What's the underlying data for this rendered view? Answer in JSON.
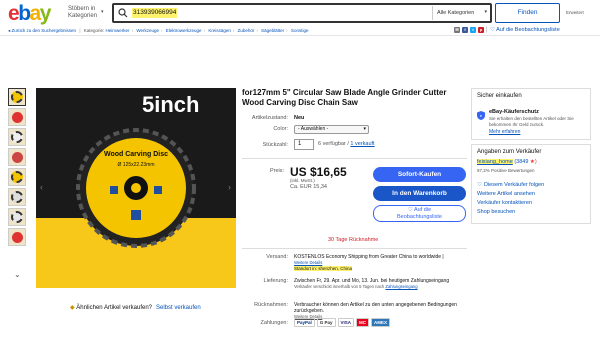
{
  "header": {
    "logo": [
      "e",
      "b",
      "a",
      "y"
    ],
    "category_line1": "Stöbern in",
    "category_line2": "Kategorien",
    "search_value": "313939066994",
    "all_categories": "Alle Kategorien",
    "find_button": "Finden",
    "advanced": "Erweitert"
  },
  "breadcrumb": {
    "back": "Zurück zu den Suchergebnissen",
    "category_label": "Kategorie:",
    "items": [
      "Heimwerker",
      "Werkzeuge",
      "Elektrowerkzeuge",
      "Kreissägen",
      "Zubehör",
      "Sägeblätter",
      "Sonstige"
    ]
  },
  "share": {
    "icons": [
      "mail-icon",
      "facebook-icon",
      "twitter-icon",
      "pinterest-icon"
    ],
    "watch": "Auf die Beobachtungsliste"
  },
  "gallery": {
    "headline": "5inch",
    "blade_text": "Wood Carving Disc",
    "blade_size": "Ø 125x22.23mm",
    "zoom_hint": "",
    "similar_q": "Ähnlichen Artikel verkaufen?",
    "similar_link": "Selbst verkaufen"
  },
  "product": {
    "title": "for127mm 5\" Circular Saw Blade Angle Grinder Cutter Wood Carving Disc Chain Saw",
    "condition_label": "Artikelzustand:",
    "condition_value": "Neu",
    "color_label": "Color:",
    "color_value": "- Auswählen -",
    "qty_label": "Stückzahl:",
    "qty_value": "1",
    "avail": "6 verfügbar / ",
    "sold": "1 verkauft",
    "price_label": "Preis:",
    "price": "US $16,65",
    "price_incl": "(inkl. MwSt.)",
    "price_eur": "Ca. EUR 15,34",
    "buy_now": "Sofort-Kaufen",
    "add_cart": "In den Warenkorb",
    "watch_line1": "♡ Auf die",
    "watch_line2": "Beobachtungsliste",
    "returns": "30 Tage Rücknahme",
    "ship_label": "Versand:",
    "ship_value": "KOSTENLOS   Economy Shipping from Greater China to worldwide |",
    "ship_details": "Weitere Details",
    "location": "Standort in: shenzhen, China",
    "delivery_label": "Lieferung:",
    "delivery_value": "Zwischen Fr, 29. Apr. und Mo, 13. Jun. bei heutigem Zahlungseingang",
    "delivery_note": "Verkäufer verschickt innerhalb von 5 Tagen nach",
    "delivery_note_link": "Zahlungseingang",
    "returns_label": "Rücknahmen:",
    "returns_value": "Verbraucher können den Artikel zu den unten angegebenen Bedingungen zurückgeben.",
    "returns_link": "Weitere Details",
    "payments_label": "Zahlungen:",
    "payments": [
      "PayPal",
      "G Pay",
      "VISA",
      "MC",
      "AMEX"
    ]
  },
  "buyer_box": {
    "title": "Sicher einkaufen",
    "protection": "eBay-Käuferschutz",
    "text": "Sie erhalten den bestellten Artikel oder Sie bekommen Ihr Geld zurück.",
    "more": "Mehr erfahren"
  },
  "seller_box": {
    "title": "Angaben zum Verkäufer",
    "name": "feixiang_home",
    "count": "(3849",
    "star": " ★)",
    "positive": "97,2% Positive Bewertungen",
    "links": [
      "Diesem Verkäufer folgen",
      "Weitere Artikel ansehen",
      "Verkäufer kontaktieren",
      "Shop besuchen"
    ]
  },
  "colors": {
    "accent": "#3665f3",
    "link": "#0654ba",
    "highlight": "#fff36d",
    "return_red": "#d01c24"
  }
}
